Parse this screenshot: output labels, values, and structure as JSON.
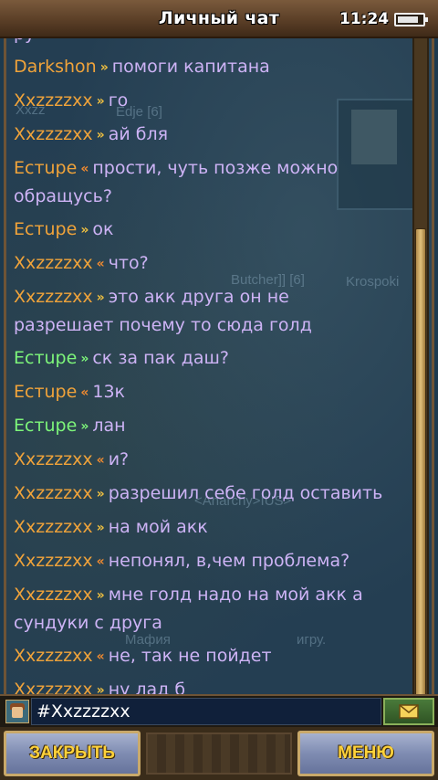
{
  "header": {
    "title": "Личный чат",
    "clock": "11:24",
    "battery_level": 0.85
  },
  "background_names": {
    "name1": "Xxzz",
    "name2": "Edje [6]",
    "name3": "Butcher]] [6]",
    "name4": "Krospoki",
    "name5": "<Anarchy>IUS>",
    "name6": "Мафия",
    "name7": "игру."
  },
  "chat": {
    "clipped_top": "ру",
    "messages": [
      {
        "name": "Darkshon",
        "arrow": "»",
        "dir": "out",
        "text": "помоги капитана",
        "name_color": "default"
      },
      {
        "name": "Xxzzzzxx",
        "arrow": "»",
        "dir": "out",
        "text": "го",
        "name_color": "default"
      },
      {
        "name": "Xxzzzzxx",
        "arrow": "»",
        "dir": "out",
        "text": "ай бля",
        "name_color": "default"
      },
      {
        "name": "Ecтupe",
        "arrow": "«",
        "dir": "in",
        "text": "прости, чуть позже можно",
        "cont": "обращусь?",
        "name_color": "default"
      },
      {
        "name": "Ecтupe",
        "arrow": "»",
        "dir": "out",
        "text": "ок",
        "name_color": "default"
      },
      {
        "name": "Xxzzzzxx",
        "arrow": "«",
        "dir": "in",
        "text": "что?",
        "name_color": "default"
      },
      {
        "name": "Xxzzzzxx",
        "arrow": "»",
        "dir": "out",
        "text": "это акк друга он не",
        "cont": "разрешает почему то сюда голд",
        "name_color": "default"
      },
      {
        "name": "Ecтupe",
        "arrow": "»",
        "dir": "out",
        "text": "ск за пак даш?",
        "name_color": "green"
      },
      {
        "name": "Ecтupe",
        "arrow": "«",
        "dir": "in",
        "text": "13к",
        "name_color": "default"
      },
      {
        "name": "Ecтupe",
        "arrow": "»",
        "dir": "out",
        "text": "лан",
        "name_color": "green"
      },
      {
        "name": "Xxzzzzxx",
        "arrow": "«",
        "dir": "in",
        "text": "и?",
        "name_color": "default"
      },
      {
        "name": "Xxzzzzxx",
        "arrow": "»",
        "dir": "out",
        "text": "разрешил себе голд оставить",
        "name_color": "default"
      },
      {
        "name": "Xxzzzzxx",
        "arrow": "»",
        "dir": "out",
        "text": "на мой акк",
        "name_color": "default"
      },
      {
        "name": "Xxzzzzxx",
        "arrow": "«",
        "dir": "in",
        "text": "непонял, в,чем проблема?",
        "name_color": "default"
      },
      {
        "name": "Xxzzzzxx",
        "arrow": "»",
        "dir": "out",
        "text": "мне голд надо на мой акк а",
        "cont": "сундуки с друга",
        "name_color": "default"
      },
      {
        "name": "Xxzzzzxx",
        "arrow": "«",
        "dir": "in",
        "text": "не, так не пойдет",
        "name_color": "default"
      },
      {
        "name": "Xxzzzzxx",
        "arrow": "»",
        "dir": "out",
        "text": "ну лад б",
        "name_color": "default"
      }
    ]
  },
  "input": {
    "value": "#Xxzzzzxx",
    "send_icon": "envelope-icon"
  },
  "buttons": {
    "close_label": "ЗАКРЫТЬ",
    "menu_label": "МЕНЮ"
  },
  "colors": {
    "name_default": "#f0a33a",
    "name_green": "#7df57a",
    "message_text": "#cdb3f5",
    "button_text": "#ffd23a"
  }
}
